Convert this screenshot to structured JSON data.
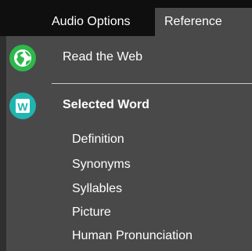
{
  "tabs": {
    "audio_options": "Audio Options",
    "reference": "Reference"
  },
  "menu": {
    "read_the_web": {
      "label": "Read the Web",
      "icon": "globe-icon",
      "icon_color": "#2db84b"
    },
    "selected_word": {
      "label": "Selected Word",
      "icon": "word-w-icon",
      "icon_letter": "W",
      "icon_color": "#1fb5b0"
    },
    "subitems": [
      {
        "label": "Definition"
      },
      {
        "label": "Synonyms"
      },
      {
        "label": "Syllables"
      },
      {
        "label": "Picture"
      },
      {
        "label": "Human Pronunciation"
      }
    ]
  },
  "colors": {
    "menu_background": "#494949",
    "topbar_background": "#0f0f0f",
    "text": "#ffffff"
  }
}
